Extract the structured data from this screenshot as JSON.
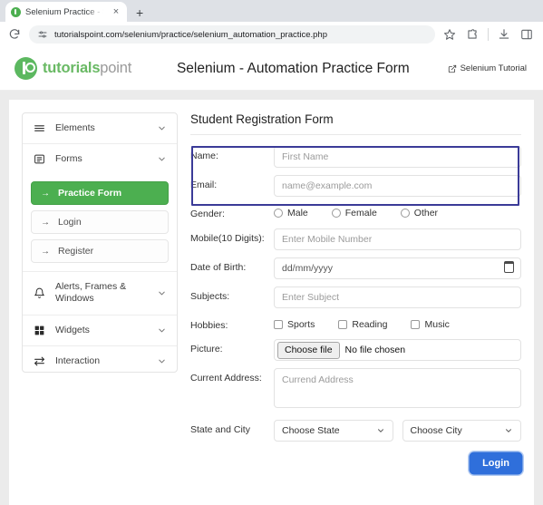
{
  "browser": {
    "tab": {
      "title": "Selenium Practice - Student F",
      "favicon": "tutorialspoint-favicon",
      "close_label": "×"
    },
    "new_tab_label": "+",
    "toolbar": {
      "reload_icon": "reload-icon",
      "site_info_icon": "tune-icon",
      "url": "tutorialspoint.com/selenium/practice/selenium_automation_practice.php",
      "bookmark_icon": "star-icon",
      "extensions_icon": "puzzle-icon",
      "downloads_icon": "download-icon",
      "sidepanel_icon": "side-panel-icon"
    }
  },
  "site_header": {
    "logo_primary": "tutorials",
    "logo_secondary": "point",
    "title": "Selenium - Automation Practice Form",
    "tutorial_link": "Selenium Tutorial",
    "external_link_icon": "external-link-icon"
  },
  "sidebar": {
    "groups": [
      {
        "label": "Elements",
        "icon": "hamburger-icon",
        "chevron": "chevron-down-icon"
      },
      {
        "label": "Forms",
        "icon": "list-box-icon",
        "chevron": "chevron-down-icon"
      },
      {
        "label": "Alerts, Frames & Windows",
        "icon": "bell-icon",
        "chevron": "chevron-down-icon"
      },
      {
        "label": "Widgets",
        "icon": "grid-icon",
        "chevron": "chevron-down-icon"
      },
      {
        "label": "Interaction",
        "icon": "exchange-arrows-icon",
        "chevron": "chevron-down-icon"
      }
    ],
    "forms_subitems": [
      {
        "label": "Practice Form",
        "active": true
      },
      {
        "label": "Login",
        "active": false
      },
      {
        "label": "Register",
        "active": false
      }
    ],
    "arrow_icon": "arrow-right-icon",
    "active_color": "#4caf50"
  },
  "form": {
    "title": "Student Registration Form",
    "name": {
      "label": "Name:",
      "placeholder": "First Name"
    },
    "email": {
      "label": "Email:",
      "placeholder": "name@example.com"
    },
    "gender": {
      "label": "Gender:",
      "options": [
        "Male",
        "Female",
        "Other"
      ]
    },
    "mobile": {
      "label": "Mobile(10 Digits):",
      "placeholder": "Enter Mobile Number"
    },
    "dob": {
      "label": "Date of Birth:",
      "value": "dd/mm/yyyy",
      "icon": "calendar-icon"
    },
    "subjects": {
      "label": "Subjects:",
      "placeholder": "Enter Subject"
    },
    "hobbies": {
      "label": "Hobbies:",
      "options": [
        "Sports",
        "Reading",
        "Music"
      ]
    },
    "picture": {
      "label": "Picture:",
      "button": "Choose file",
      "status": "No file chosen"
    },
    "address": {
      "label": "Current Address:",
      "placeholder": "Currend Address"
    },
    "state_city": {
      "label": "State and City",
      "state_value": "Choose State",
      "city_value": "Choose City",
      "chevron": "chevron-down-icon"
    },
    "submit": {
      "label": "Login",
      "color": "#2f6fdb"
    }
  }
}
